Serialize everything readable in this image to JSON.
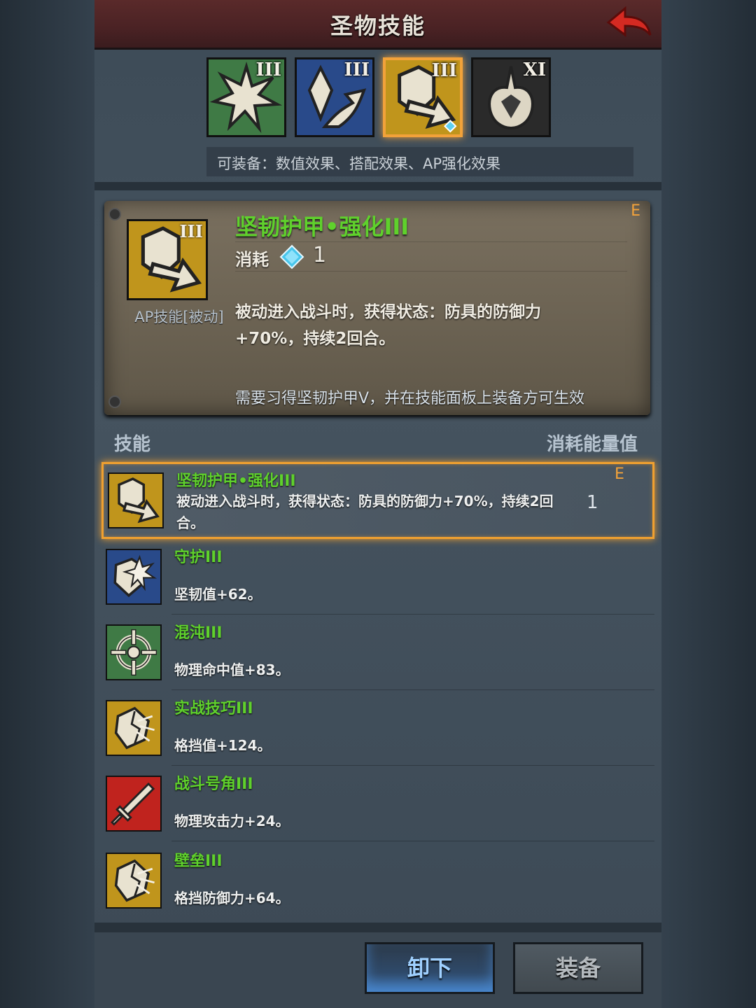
{
  "header": {
    "title": "圣物技能"
  },
  "relics": [
    {
      "icon": "starburst-icon",
      "level": "III",
      "color": "#3f7a45"
    },
    {
      "icon": "crystal-bird-icon",
      "level": "III",
      "color": "#294a8a"
    },
    {
      "icon": "shield-arrow-icon",
      "level": "III",
      "color": "#c0951c",
      "active": true
    },
    {
      "icon": "horned-relic-icon",
      "level": "XI",
      "color": "#2a2a2a"
    }
  ],
  "equipable_text": "可装备：数值效果、搭配效果、AP强化效果",
  "detail": {
    "name": "坚韧护甲•强化III",
    "icon_level": "III",
    "type": "AP技能[被动]",
    "cost_label": "消耗",
    "cost_value": "1",
    "grade": "E",
    "description_line1": "被动进入战斗时，获得状态：防具的防御力",
    "description_line2": "+70%，持续2回合。",
    "requirement": "需要习得坚韧护甲V，并在技能面板上装备方可生效"
  },
  "list_header": {
    "skill": "技能",
    "cost": "消耗能量值"
  },
  "skills": [
    {
      "name": "坚韧护甲•强化III",
      "desc": "被动进入战斗时，获得状态：防具的防御力+70%，持续2回合。",
      "cost": "1",
      "grade": "E",
      "icon": "shield-arrow-icon",
      "color": "#c0951c",
      "selected": true
    },
    {
      "name": "守护III",
      "desc": "坚韧值+62。",
      "icon": "shield-burst-icon",
      "color": "#294a8a"
    },
    {
      "name": "混沌III",
      "desc": "物理命中值+83。",
      "icon": "crosshair-icon",
      "color": "#3f7a45"
    },
    {
      "name": "实战技巧III",
      "desc": "格挡值+124。",
      "icon": "cracked-shield-icon",
      "color": "#c0951c"
    },
    {
      "name": "战斗号角III",
      "desc": "物理攻击力+24。",
      "icon": "sword-icon",
      "color": "#c0231e"
    },
    {
      "name": "壁垒III",
      "desc": "格挡防御力+64。",
      "icon": "cracked-shield-icon",
      "color": "#c0951c"
    }
  ],
  "buttons": {
    "unequip": "卸下",
    "equip": "装备"
  }
}
